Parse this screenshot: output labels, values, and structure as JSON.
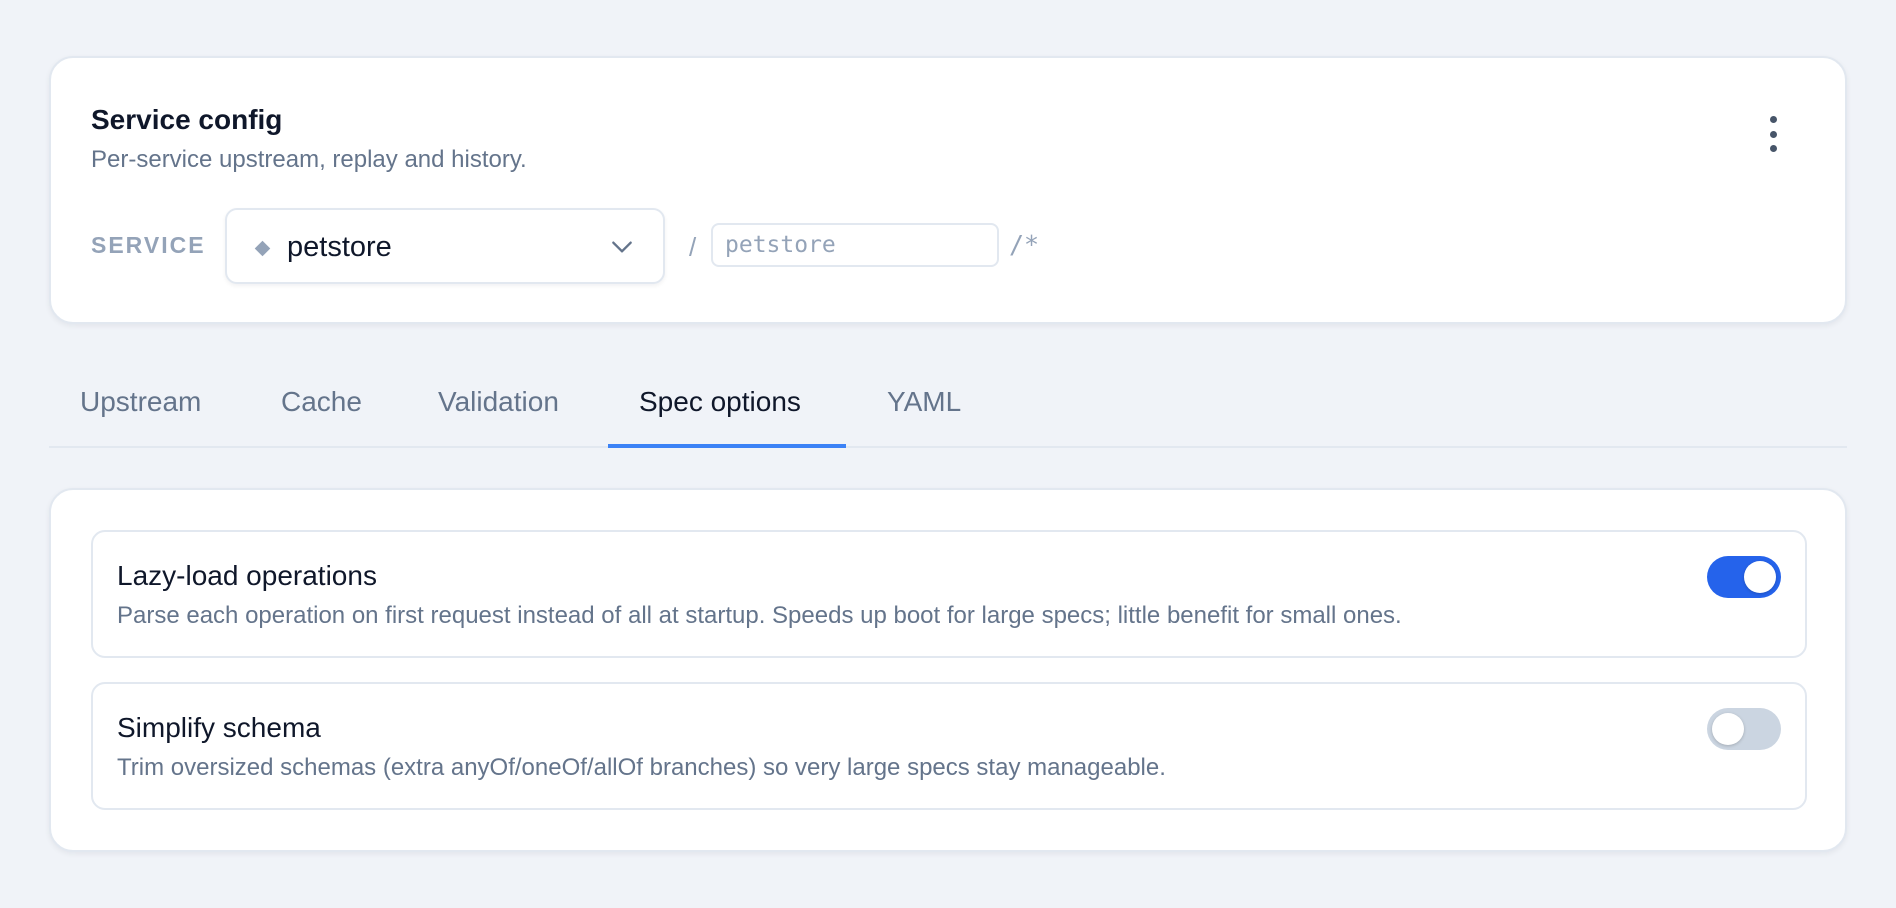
{
  "header": {
    "title": "Service config",
    "subtitle": "Per-service upstream, replay and history.",
    "menu_icon": "more-vertical-icon"
  },
  "service": {
    "label": "SERVICE",
    "selected": "petstore",
    "path_prefix": "/",
    "path_value": "",
    "path_placeholder": "petstore",
    "path_suffix": "/*"
  },
  "tabs": [
    {
      "label": "Upstream",
      "active": false
    },
    {
      "label": "Cache",
      "active": false
    },
    {
      "label": "Validation",
      "active": false
    },
    {
      "label": "Spec options",
      "active": true
    },
    {
      "label": "YAML",
      "active": false
    }
  ],
  "options": [
    {
      "title": "Lazy-load operations",
      "description": "Parse each operation on first request instead of all at startup. Speeds up boot for large specs; little benefit for small ones.",
      "enabled": true
    },
    {
      "title": "Simplify schema",
      "description": "Trim oversized schemas (extra anyOf/oneOf/allOf branches) so very large specs stay manageable.",
      "enabled": false
    }
  ],
  "colors": {
    "accent": "#2563eb",
    "tab_indicator": "#3b82f6",
    "background": "#f0f3f8"
  }
}
